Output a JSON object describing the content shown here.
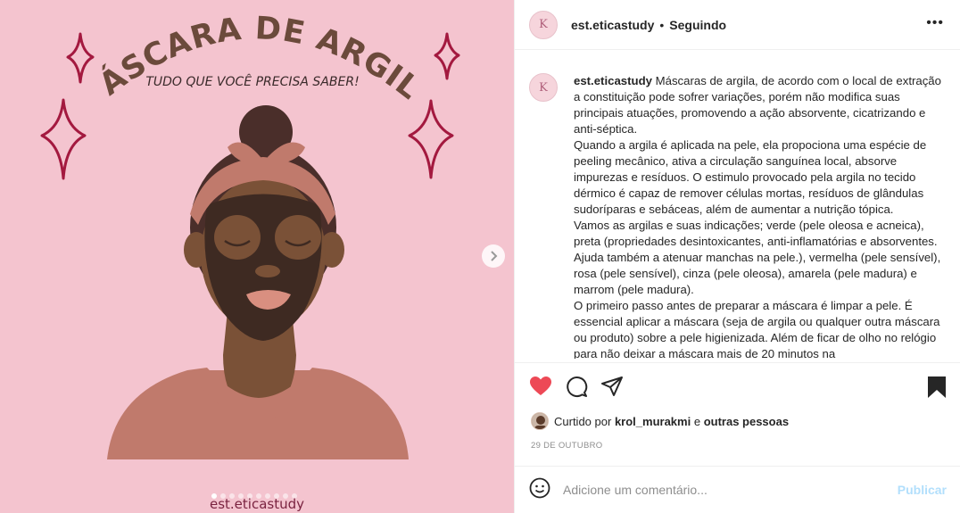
{
  "post_image": {
    "title_text": "MÁSCARA DE ARGILA",
    "subtitle_text": "TUDO QUE VOCÊ PRECISA SABER!",
    "watermark": "est.eticastudy",
    "carousel_dots": 10,
    "active_dot": 0,
    "colors": {
      "background": "#f4c4cf",
      "title": "#6b4a3b",
      "sparkle": "#a3193f",
      "skin": "#7a5137",
      "mask": "#3e2a22"
    }
  },
  "header": {
    "avatar_letter": "K",
    "username": "est.eticastudy",
    "separator": "•",
    "follow_status": "Seguindo",
    "more_icon": "more-horizontal-icon"
  },
  "caption": {
    "avatar_letter": "K",
    "username": "est.eticastudy",
    "paragraphs": [
      "Máscaras de argila, de acordo com o local de extração a constituição pode sofrer variações, porém não modifica suas principais atuações, promovendo a ação absorvente, cicatrizando e anti-séptica.",
      "Quando a argila é aplicada na pele, ela propociona uma espécie de peeling mecânico, ativa a circulação sanguínea local, absorve impurezas e resíduos. O estimulo provocado pela argila no tecido dérmico é capaz de remover células mortas, resíduos de glândulas sudoríparas e sebáceas, além de aumentar a nutrição tópica.",
      "Vamos as argilas e suas indicações; verde (pele oleosa e acneica), preta (propriedades desintoxicantes, anti-inflamatórias e absorventes. Ajuda também a atenuar manchas na pele.), vermelha (pele sensível), rosa (pele sensível), cinza (pele oleosa), amarela (pele madura) e marrom (pele madura).",
      "O primeiro passo antes de preparar a máscara é limpar a pele. É essencial aplicar a máscara (seja de argila ou qualquer outra máscara ou produto) sobre a pele higienizada. Além de ficar de olho no relógio para não deixar a máscara mais de 20 minutos na"
    ]
  },
  "actions": {
    "like_icon": "heart-filled-icon",
    "comment_icon": "comment-icon",
    "share_icon": "share-icon",
    "save_icon": "bookmark-filled-icon",
    "liked": true,
    "like_color": "#ed4956"
  },
  "likes": {
    "prefix": "Curtido por",
    "user": "krol_murakmi",
    "conjunction": "e",
    "others": "outras pessoas"
  },
  "date": "29 DE OUTUBRO",
  "comment": {
    "placeholder": "Adicione um comentário...",
    "publish_label": "Publicar",
    "emoji_icon": "emoji-icon"
  }
}
